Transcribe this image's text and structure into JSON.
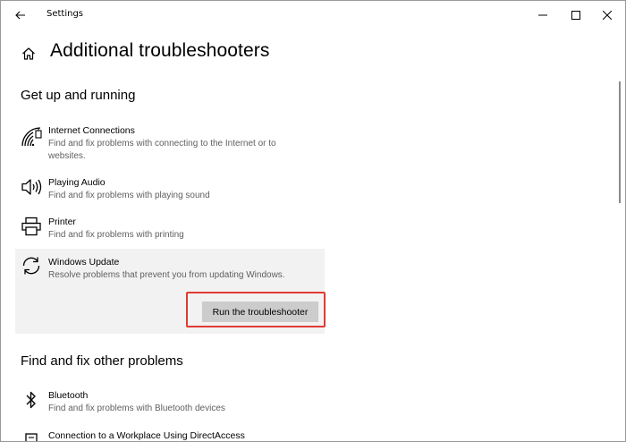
{
  "window": {
    "title": "Settings"
  },
  "header": {
    "page_title": "Additional troubleshooters"
  },
  "sections": [
    {
      "title": "Get up and running",
      "items": [
        {
          "name": "Internet Connections",
          "desc_line1": "Find and fix problems with connecting to the Internet or to",
          "desc_line2": "websites.",
          "icon": "wifi-signal-icon"
        },
        {
          "name": "Playing Audio",
          "desc_line1": "Find and fix problems with playing sound",
          "icon": "speaker-icon"
        },
        {
          "name": "Printer",
          "desc_line1": "Find and fix problems with printing",
          "icon": "printer-icon"
        },
        {
          "name": "Windows Update",
          "desc_line1": "Resolve problems that prevent you from updating Windows.",
          "icon": "sync-icon",
          "selected": true,
          "button_label": "Run the troubleshooter"
        }
      ]
    },
    {
      "title": "Find and fix other problems",
      "items": [
        {
          "name": "Bluetooth",
          "desc_line1": "Find and fix problems with Bluetooth devices",
          "icon": "bluetooth-icon"
        },
        {
          "name": "Connection to a Workplace Using DirectAccess",
          "icon": "workplace-icon"
        }
      ]
    }
  ],
  "colors": {
    "highlight": "#e03a35",
    "selected_bg": "#f2f2f2",
    "button_bg": "#cccccc",
    "desc_text": "#5f5f5f"
  }
}
